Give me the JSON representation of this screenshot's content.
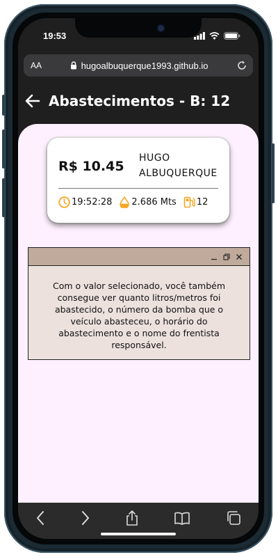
{
  "status": {
    "time": "19:53"
  },
  "browser": {
    "aa_label": "AA",
    "url": "hugoalbuquerque1993.github.io"
  },
  "header": {
    "title": "Abastecimentos - B: 12"
  },
  "card": {
    "price": "R$ 10.45",
    "name_line1": "HUGO",
    "name_line2": "ALBUQUERQUE",
    "time": "19:52:28",
    "volume": "2.686 Mts",
    "pump": "12"
  },
  "tooltip": {
    "text": "Com o valor selecionado, você também consegue ver quanto litros/metros foi abastecido, o número da bomba que o veículo abasteceu, o horário do abastecimento e o nome do frentista responsável."
  },
  "colors": {
    "accent": "#f5a623",
    "content_bg": "#fff0ff",
    "tooltip_bg": "#ece1dd",
    "tooltip_bar": "#bfaa9b"
  },
  "icons": [
    "signal-icon",
    "wifi-icon",
    "battery-icon",
    "lock-icon",
    "reload-icon",
    "back-arrow-icon",
    "clock-icon",
    "drop-icon",
    "fuel-pump-icon",
    "minimize-icon",
    "restore-icon",
    "close-icon",
    "chevron-left-icon",
    "chevron-right-icon",
    "share-icon",
    "bookmarks-icon",
    "tabs-icon"
  ]
}
